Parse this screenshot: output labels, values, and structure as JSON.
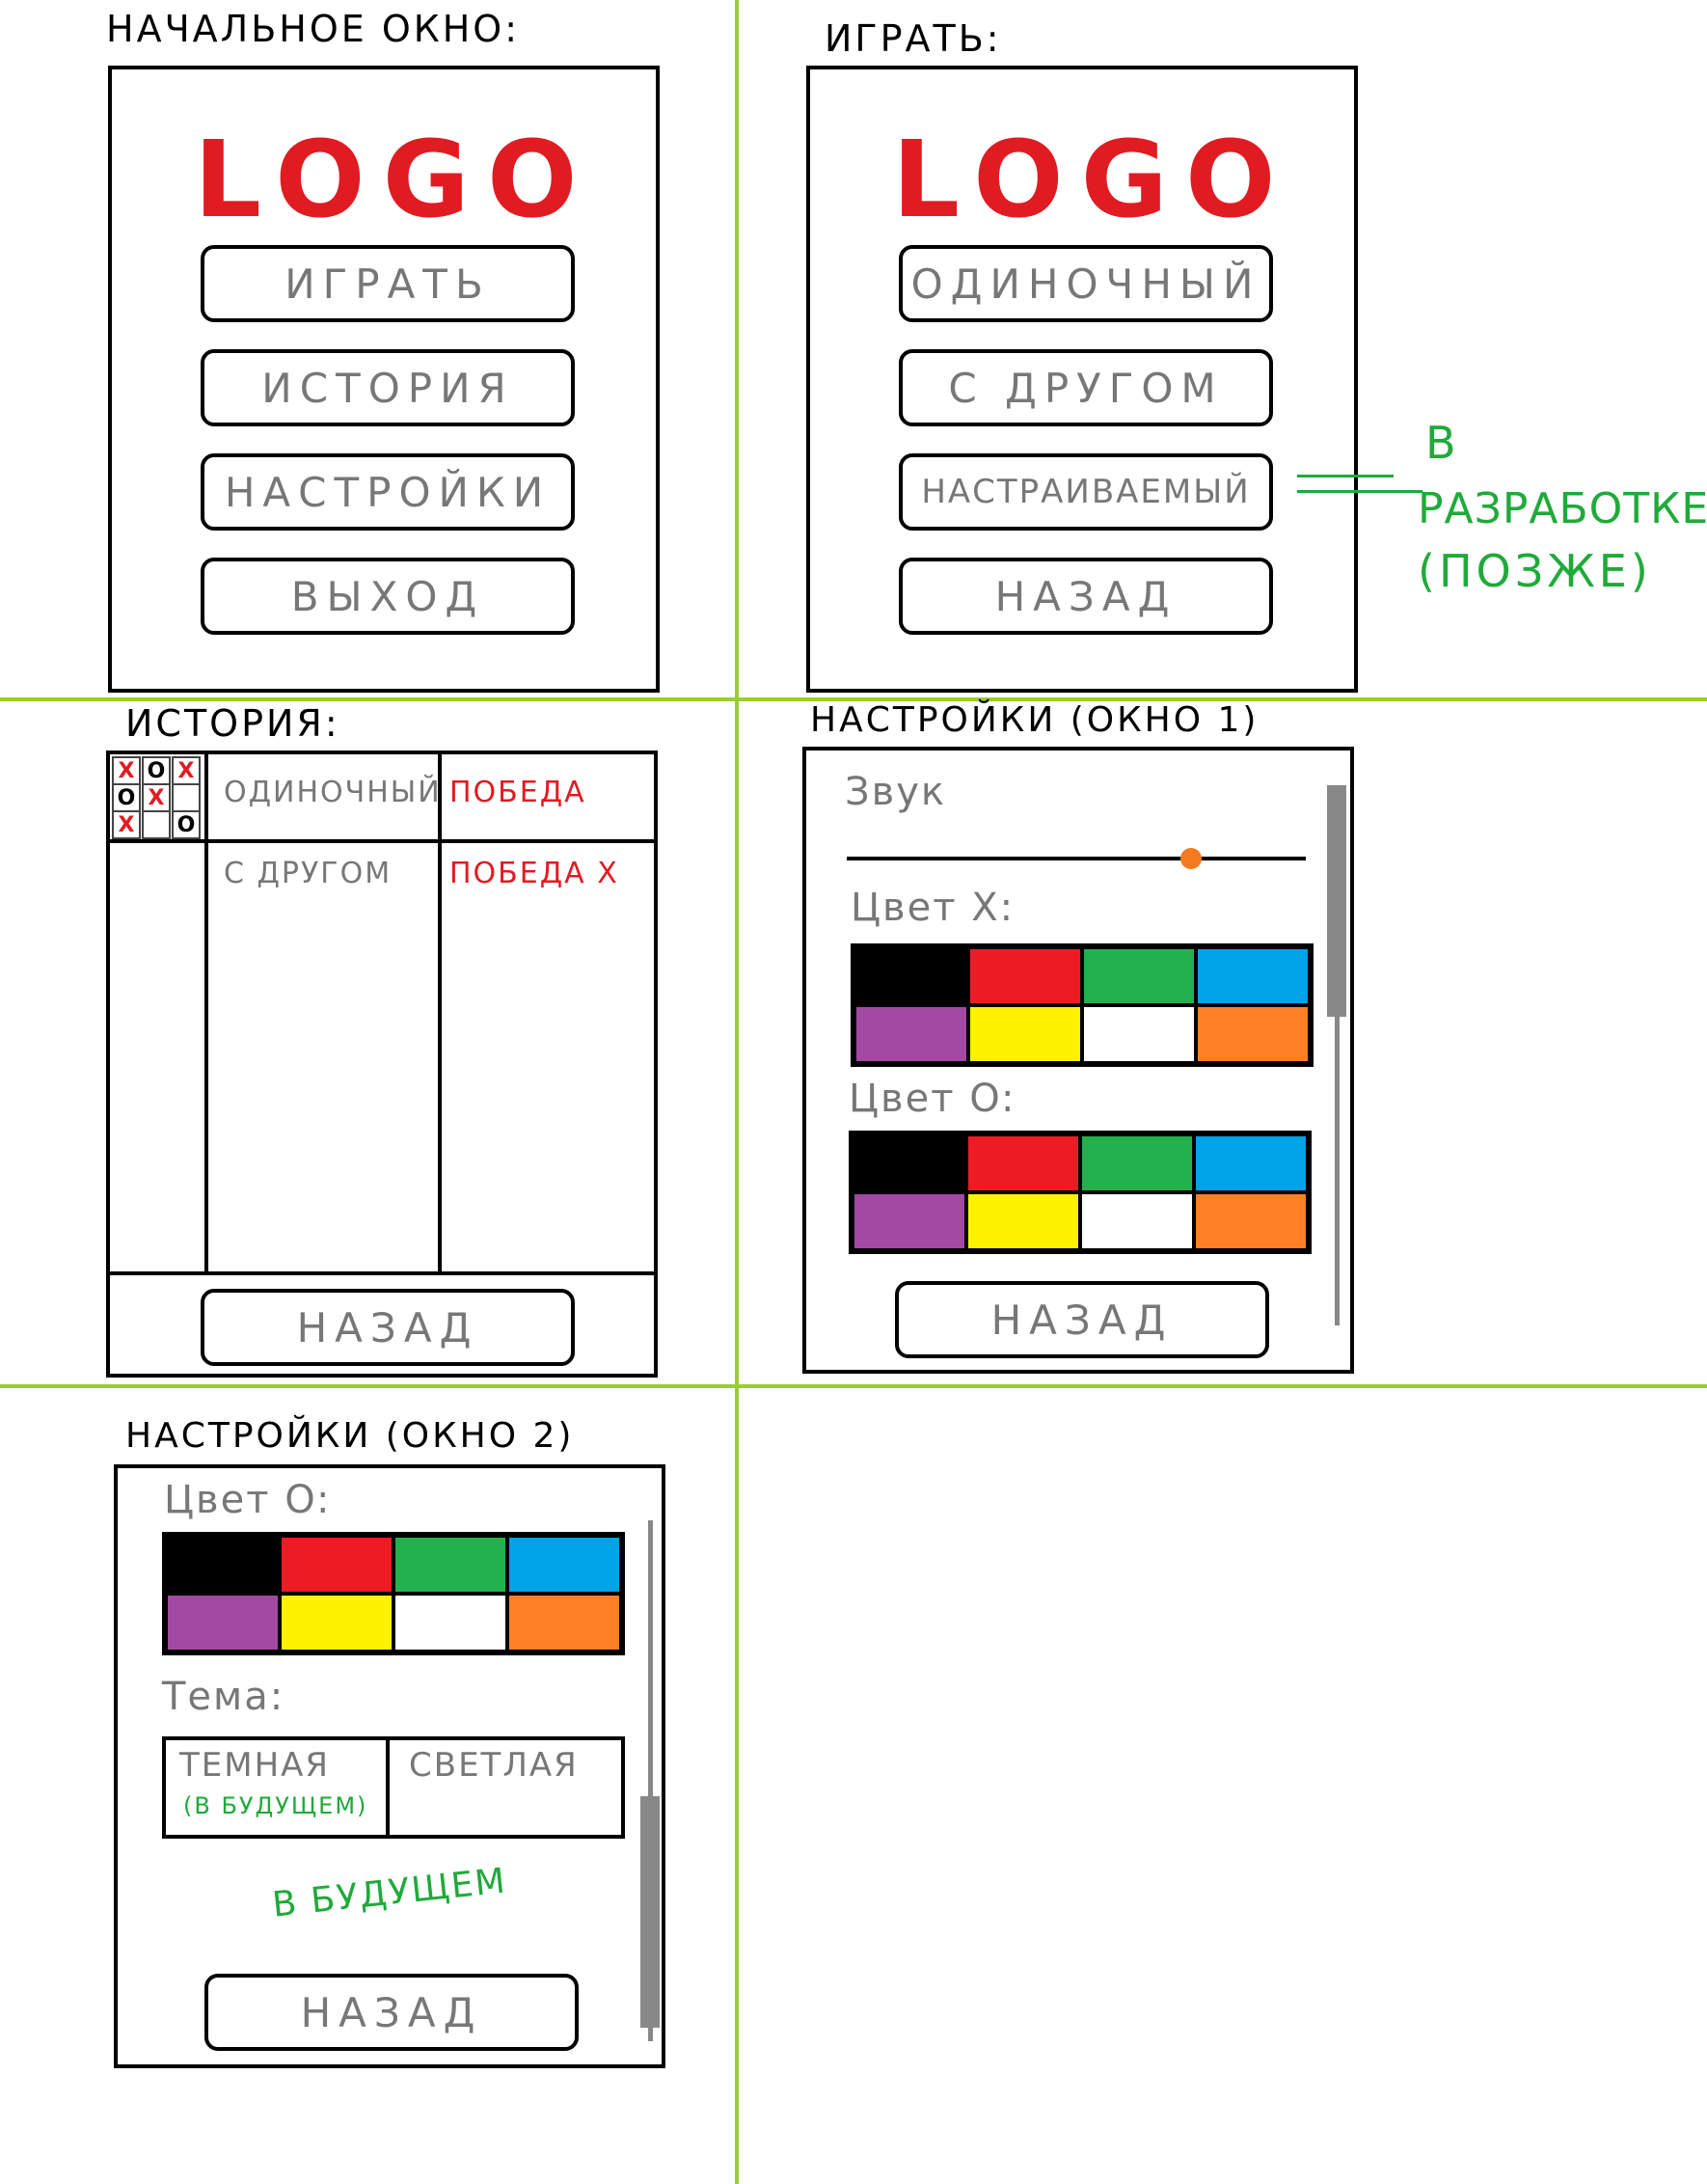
{
  "colors": {
    "grid": "#9acd32",
    "logo": "#e11b22",
    "win_red": "#e11b22",
    "note_green": "#1faa3a",
    "button_text": "#777777"
  },
  "palette_colors": [
    "#000000",
    "#ed1c24",
    "#22b14c",
    "#00a2e8",
    "#a349a4",
    "#fff200",
    "#ffffff",
    "#ff7f27"
  ],
  "start_window": {
    "title": "НАЧАЛЬНОЕ ОКНО:",
    "logo": "LOGO",
    "buttons": [
      "ИГРАТЬ",
      "ИСТОРИЯ",
      "НАСТРОЙКИ",
      "ВЫХОД"
    ]
  },
  "play_window": {
    "title": "ИГРАТЬ:",
    "logo": "LOGO",
    "buttons": [
      "ОДИНОЧНЫЙ",
      "С ДРУГОМ",
      "НАСТРАИВАЕМЫЙ",
      "НАЗАД"
    ],
    "note": [
      "В",
      "РАЗРАБОТКЕ",
      "(ПОЗЖЕ)"
    ]
  },
  "history_window": {
    "title": "ИСТОРИЯ:",
    "mini_board": [
      "X",
      "O",
      "X",
      "O",
      "X",
      "",
      "X",
      "",
      "O"
    ],
    "rows": [
      {
        "mode": "ОДИНОЧНЫЙ",
        "result": "ПОБЕДА"
      },
      {
        "mode": "С ДРУГОМ",
        "result": "ПОБЕДА X"
      }
    ],
    "back": "НАЗАД"
  },
  "settings1_window": {
    "title": "НАСТРОЙКИ (ОКНО 1)",
    "sound_label": "Звук",
    "sound_level": 0.75,
    "slider_color": "#f47a20",
    "color_x_label": "Цвет X:",
    "color_o_label": "Цвет O:",
    "back": "НАЗАД"
  },
  "settings2_window": {
    "title": "НАСТРОЙКИ (ОКНО 2)",
    "color_o_label": "Цвет O:",
    "theme_label": "Тема:",
    "theme_dark": "ТЕМНАЯ",
    "theme_dark_note": "(В БУДУЩЕМ)",
    "theme_light": "СВЕТЛАЯ",
    "future_note": "В БУДУЩЕМ",
    "back": "НАЗАД"
  }
}
